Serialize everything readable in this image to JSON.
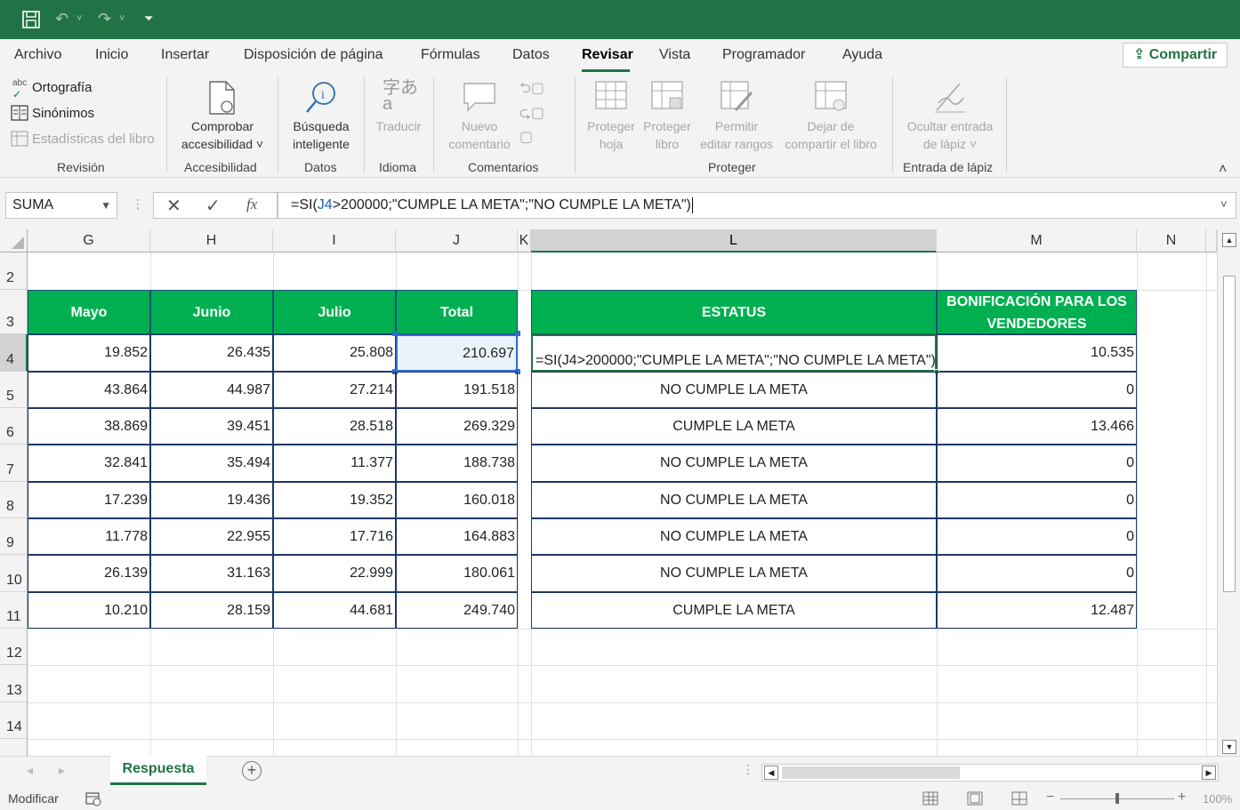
{
  "ribbon_tabs": [
    "Archivo",
    "Inicio",
    "Insertar",
    "Disposición de página",
    "Fórmulas",
    "Datos",
    "Revisar",
    "Vista",
    "Programador",
    "Ayuda"
  ],
  "active_tab": "Revisar",
  "share_label": "Compartir",
  "ribbon": {
    "ortografia": "Ortografía",
    "sinonimos": "Sinónimos",
    "estadisticas": "Estadísticas del libro",
    "grp_revision": "Revisión",
    "comprobar_1": "Comprobar",
    "comprobar_2": "accesibilidad ˅",
    "grp_accesibilidad": "Accesibilidad",
    "busqueda_1": "Búsqueda",
    "busqueda_2": "inteligente",
    "grp_datos": "Datos",
    "traducir": "Traducir",
    "grp_idioma": "Idioma",
    "nuevo_1": "Nuevo",
    "nuevo_2": "comentario",
    "grp_comentarios": "Comentarios",
    "proteger_hoja_1": "Proteger",
    "proteger_hoja_2": "hoja",
    "proteger_libro_1": "Proteger",
    "proteger_libro_2": "libro",
    "permitir_1": "Permitir",
    "permitir_2": "editar rangos",
    "dejar_1": "Dejar de",
    "dejar_2": "compartir el libro",
    "grp_proteger": "Proteger",
    "ocultar_1": "Ocultar entrada",
    "ocultar_2": "de lápiz ˅",
    "grp_lapiz": "Entrada de lápiz"
  },
  "name_box": "SUMA",
  "formula_parts": [
    "=SI(",
    "J4",
    ">200000;\"CUMPLE LA META\";\"NO CUMPLE LA META\")"
  ],
  "columns": [
    "G",
    "H",
    "I",
    "J",
    "K",
    "L",
    "M",
    "N"
  ],
  "row_numbers": [
    "2",
    "3",
    "4",
    "5",
    "6",
    "7",
    "8",
    "9",
    "10",
    "11",
    "12",
    "13",
    "14"
  ],
  "headers": {
    "mayo": "Mayo",
    "junio": "Junio",
    "julio": "Julio",
    "total": "Total",
    "estatus": "ESTATUS",
    "bonificacion": "BONIFICACIÓN PARA LOS VENDEDORES"
  },
  "rows": [
    {
      "mayo": "19.852",
      "junio": "26.435",
      "julio": "25.808",
      "total": "210.697",
      "estatus": "=SI(J4>200000;\"CUMPLE LA META\";\"NO CUMPLE LA META\")",
      "bono": "10.535"
    },
    {
      "mayo": "43.864",
      "junio": "44.987",
      "julio": "27.214",
      "total": "191.518",
      "estatus": "NO CUMPLE LA META",
      "bono": "0"
    },
    {
      "mayo": "38.869",
      "junio": "39.451",
      "julio": "28.518",
      "total": "269.329",
      "estatus": "CUMPLE LA META",
      "bono": "13.466"
    },
    {
      "mayo": "32.841",
      "junio": "35.494",
      "julio": "11.377",
      "total": "188.738",
      "estatus": "NO CUMPLE LA META",
      "bono": "0"
    },
    {
      "mayo": "17.239",
      "junio": "19.436",
      "julio": "19.352",
      "total": "160.018",
      "estatus": "NO CUMPLE LA META",
      "bono": "0"
    },
    {
      "mayo": "11.778",
      "junio": "22.955",
      "julio": "17.716",
      "total": "164.883",
      "estatus": "NO CUMPLE LA META",
      "bono": "0"
    },
    {
      "mayo": "26.139",
      "junio": "31.163",
      "julio": "22.999",
      "total": "180.061",
      "estatus": "NO CUMPLE LA META",
      "bono": "0"
    },
    {
      "mayo": "10.210",
      "junio": "28.159",
      "julio": "44.681",
      "total": "249.740",
      "estatus": "CUMPLE LA META",
      "bono": "12.487"
    }
  ],
  "sheet_tab": "Respuesta",
  "status_mode": "Modificar",
  "zoom": "100%",
  "colors": {
    "excel_green": "#217346",
    "header_fill": "#00b050",
    "reference_blue": "#1f5fbf"
  }
}
